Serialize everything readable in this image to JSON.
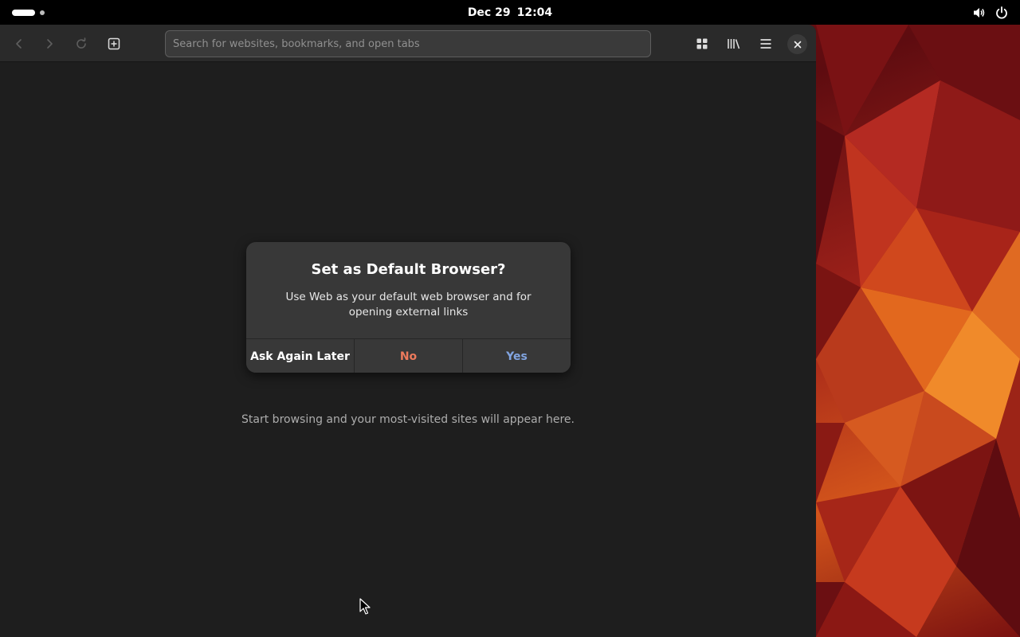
{
  "topbar": {
    "date": "Dec 29",
    "time": "12:04",
    "icons": [
      "volume-icon",
      "power-icon"
    ]
  },
  "browser": {
    "toolbar": {
      "back_icon": "back-arrow-icon",
      "forward_icon": "forward-arrow-icon",
      "reload_icon": "reload-icon",
      "new_tab_icon": "new-tab-icon",
      "search_placeholder": "Search for websites, bookmarks, and open tabs",
      "search_value": "",
      "tabs_overview_icon": "tabs-overview-icon",
      "library_icon": "library-icon",
      "menu_icon": "hamburger-menu-icon",
      "close_icon": "close-icon"
    },
    "empty_state": "Start browsing and your most-visited sites will appear here."
  },
  "dialog": {
    "title": "Set as Default Browser?",
    "body": "Use Web as your default web browser and for opening external links",
    "buttons": {
      "later": "Ask Again Later",
      "no": "No",
      "yes": "Yes"
    }
  },
  "colors": {
    "no_button": "#ee7a5c",
    "yes_button": "#81a4e0",
    "dialog_bg": "#383838",
    "window_bg": "#1e1e1e"
  }
}
